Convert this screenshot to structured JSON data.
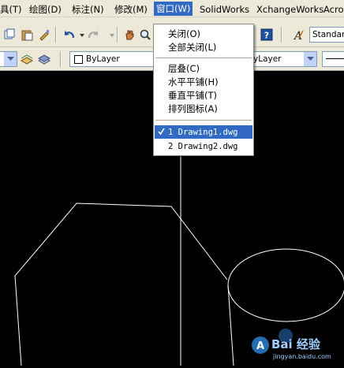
{
  "menubar": {
    "items": [
      {
        "label": "具(T)"
      },
      {
        "label": "绘图(D)"
      },
      {
        "label": "标注(N)"
      },
      {
        "label": "修改(M)"
      },
      {
        "label": "窗口(W)"
      },
      {
        "label": "SolidWorks"
      },
      {
        "label": "XchangeWorks"
      },
      {
        "label": "Acro"
      }
    ]
  },
  "toolbar": {
    "text_style": "Standar",
    "layer_combo": "ByLayer",
    "linetype_combo": "yLayer"
  },
  "window_menu": {
    "items": [
      {
        "label": "关闭(O)"
      },
      {
        "label": "全部关闭(L)"
      },
      {
        "label": "层叠(C)"
      },
      {
        "label": "水平平铺(H)"
      },
      {
        "label": "垂直平铺(T)"
      },
      {
        "label": "排列图标(A)"
      },
      {
        "label": "1 Drawing1.dwg",
        "checked": true
      },
      {
        "label": "2 Drawing2.dwg"
      }
    ]
  },
  "watermark": {
    "text": "Bai 经验",
    "sub": "jingyan.baidu.com"
  },
  "colors": {
    "menu_highlight": "#316AC5",
    "chrome": "#ECE9D8",
    "canvas": "#000000",
    "drawing_lines": "#FFFFFF"
  }
}
